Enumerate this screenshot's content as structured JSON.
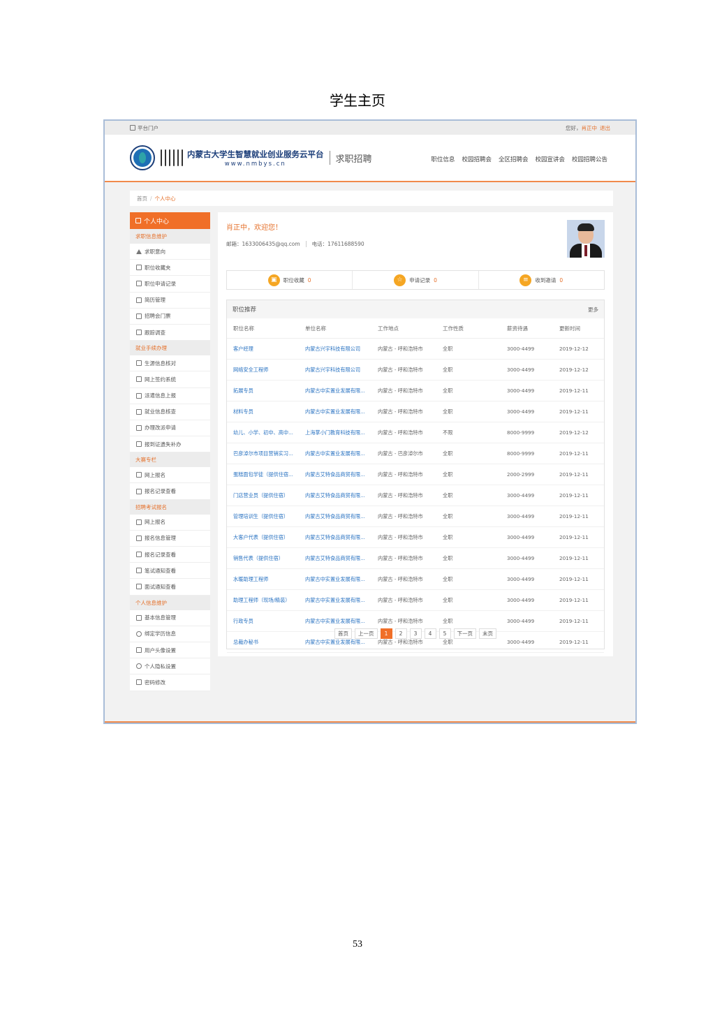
{
  "doc": {
    "title": "学生主页",
    "page_number": "53"
  },
  "topbar": {
    "portal": "平台门户",
    "greeting": "您好，",
    "user": "肖正中",
    "logout": "退出"
  },
  "header": {
    "site_name": "内蒙古大学生智慧就业创业服务云平台",
    "site_url": "www.nmbys.cn",
    "sub_brand": "求职招聘",
    "nav": [
      "职位信息",
      "校园招聘会",
      "全区招聘会",
      "校园宣讲会",
      "校园招聘公告"
    ]
  },
  "breadcrumb": {
    "home": "首页",
    "current": "个人中心"
  },
  "sidebar": {
    "head": "个人中心",
    "groups": [
      {
        "title": "求职信息维护",
        "items": [
          "求职意向",
          "职位收藏夹",
          "职位申请记录",
          "简历管理",
          "招聘会门票",
          "跟踪调查"
        ]
      },
      {
        "title": "就业手续办理",
        "items": [
          "生源信息核对",
          "网上签约系统",
          "派遣信息上报",
          "就业信息核查",
          "办理改派申请",
          "报到证遗失补办"
        ]
      },
      {
        "title": "大赛专栏",
        "items": [
          "网上报名",
          "报名记录查看"
        ]
      },
      {
        "title": "招聘考试报名",
        "items": [
          "网上报名",
          "报名信息管理",
          "报名记录查看",
          "笔试通知查看",
          "面试通知查看"
        ]
      },
      {
        "title": "个人信息维护",
        "items": [
          "基本信息管理",
          "绑定学历信息",
          "用户头像设置",
          "个人隐私设置",
          "密码修改"
        ]
      }
    ]
  },
  "profile": {
    "welcome": "肖正中，欢迎您！",
    "email": "邮箱：1633006435@qq.com",
    "phone": "电话：17611688590"
  },
  "stats": [
    {
      "label": "职位收藏",
      "value": "0"
    },
    {
      "label": "申请记录",
      "value": "0"
    },
    {
      "label": "收到邀请",
      "value": "0"
    }
  ],
  "recommend": {
    "title": "职位推荐",
    "more": "更多",
    "columns": [
      "职位名称",
      "单位名称",
      "工作地点",
      "工作性质",
      "薪资待遇",
      "更新时间"
    ],
    "rows": [
      [
        "客户经理",
        "内蒙古兴宇科技有限公司",
        "内蒙古 - 呼和浩特市",
        "全职",
        "3000-4499",
        "2019-12-12"
      ],
      [
        "网络安全工程师",
        "内蒙古兴宇科技有限公司",
        "内蒙古 - 呼和浩特市",
        "全职",
        "3000-4499",
        "2019-12-12"
      ],
      [
        "拓展专员",
        "内蒙古中实置业发展有限...",
        "内蒙古 - 呼和浩特市",
        "全职",
        "3000-4499",
        "2019-12-11"
      ],
      [
        "材料专员",
        "内蒙古中实置业发展有限...",
        "内蒙古 - 呼和浩特市",
        "全职",
        "3000-4499",
        "2019-12-11"
      ],
      [
        "幼儿、小学、初中、高中...",
        "上海掌小门教育科技有限...",
        "内蒙古 - 呼和浩特市",
        "不限",
        "8000-9999",
        "2019-12-12"
      ],
      [
        "巴彦淖尔市项目营销实习...",
        "内蒙古中实置业发展有限...",
        "内蒙古 - 巴彦淖尔市",
        "全职",
        "8000-9999",
        "2019-12-11"
      ],
      [
        "蛋糕面包学徒（提供住宿...",
        "内蒙古艾特食品商贸有限...",
        "内蒙古 - 呼和浩特市",
        "全职",
        "2000-2999",
        "2019-12-11"
      ],
      [
        "门店营业员（提供住宿）",
        "内蒙古艾特食品商贸有限...",
        "内蒙古 - 呼和浩特市",
        "全职",
        "3000-4499",
        "2019-12-11"
      ],
      [
        "管理培训生（提供住宿）",
        "内蒙古艾特食品商贸有限...",
        "内蒙古 - 呼和浩特市",
        "全职",
        "3000-4499",
        "2019-12-11"
      ],
      [
        "大客户代表（提供住宿）",
        "内蒙古艾特食品商贸有限...",
        "内蒙古 - 呼和浩特市",
        "全职",
        "3000-4499",
        "2019-12-11"
      ],
      [
        "销售代表（提供住宿）",
        "内蒙古艾特食品商贸有限...",
        "内蒙古 - 呼和浩特市",
        "全职",
        "3000-4499",
        "2019-12-11"
      ],
      [
        "水暖助理工程师",
        "内蒙古中实置业发展有限...",
        "内蒙古 - 呼和浩特市",
        "全职",
        "3000-4499",
        "2019-12-11"
      ],
      [
        "助理工程师（现场/精装）",
        "内蒙古中实置业发展有限...",
        "内蒙古 - 呼和浩特市",
        "全职",
        "3000-4499",
        "2019-12-11"
      ],
      [
        "行政专员",
        "内蒙古中实置业发展有限...",
        "内蒙古 - 呼和浩特市",
        "全职",
        "3000-4499",
        "2019-12-11"
      ],
      [
        "总裁办秘书",
        "内蒙古中实置业发展有限...",
        "内蒙古 - 呼和浩特市",
        "全职",
        "3000-4499",
        "2019-12-11"
      ]
    ]
  },
  "pager": {
    "first": "首页",
    "prev": "上一页",
    "pages": [
      "1",
      "2",
      "3",
      "4",
      "5"
    ],
    "current": "1",
    "next": "下一页",
    "last": "末页"
  },
  "colors": {
    "accent": "#f06f28",
    "link": "#2a73c2",
    "brand": "#1d3f7a"
  }
}
